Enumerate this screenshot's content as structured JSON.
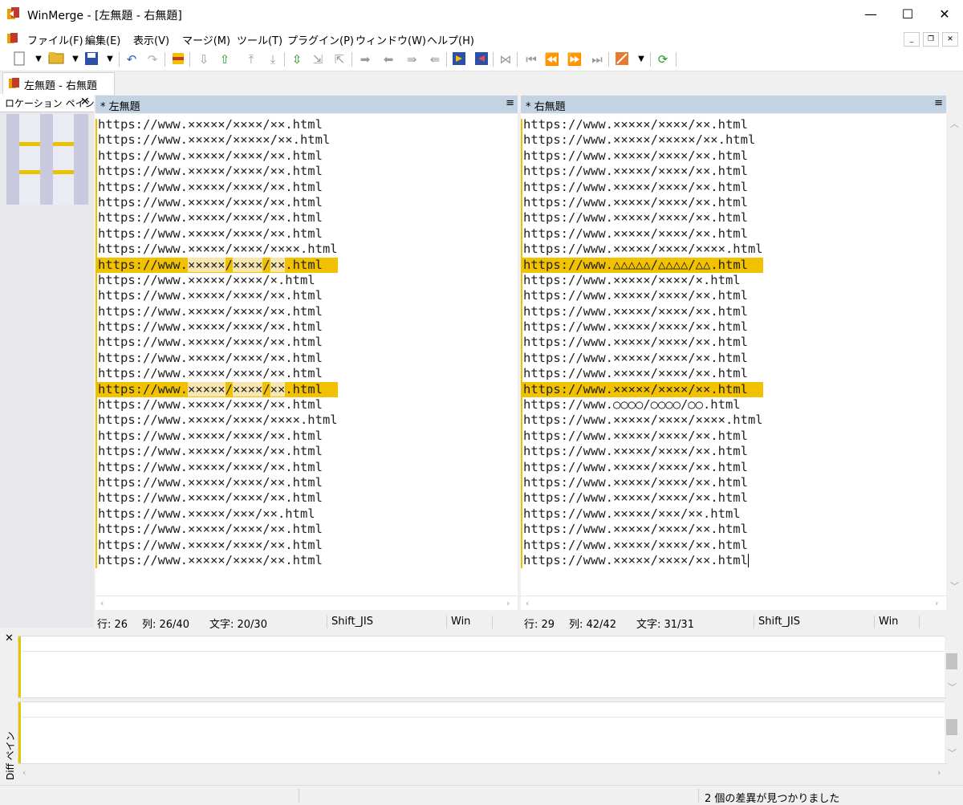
{
  "window": {
    "title": "WinMerge - [左無題 - 右無題]",
    "minimize_glyph": "—",
    "maximize_glyph": "☐",
    "close_glyph": "✕"
  },
  "menu": [
    "ファイル(F)",
    "編集(E)",
    "表示(V)",
    "マージ(M)",
    "ツール(T)",
    "プラグイン(P)",
    "ウィンドウ(W)",
    "ヘルプ(H)"
  ],
  "tab": {
    "label": "左無題 - 右無題"
  },
  "location_pane": {
    "title": "ロケーション ペイン",
    "close_glyph": "✕"
  },
  "left_pane": {
    "header": "* 左無題",
    "menu_glyph": "≡",
    "status": {
      "line": "行: 26",
      "col": "列: 26/40",
      "char": "文字: 20/30",
      "encoding": "Shift_JIS",
      "eol": "Win"
    }
  },
  "right_pane": {
    "header": "* 右無題",
    "menu_glyph": "≡",
    "status": {
      "line": "行: 29",
      "col": "列: 42/42",
      "char": "文字: 31/31",
      "encoding": "Shift_JIS",
      "eol": "Win"
    }
  },
  "left_lines": [
    "https://www.×××××/××××/××.html",
    "https://www.×××××/×××××/××.html",
    "https://www.×××××/××××/××.html",
    "https://www.×××××/××××/××.html",
    "https://www.×××××/××××/××.html",
    "https://www.×××××/××××/××.html",
    "https://www.×××××/××××/××.html",
    "https://www.×××××/××××/××.html",
    "https://www.×××××/××××/××××.html",
    "https://www.×××××/××××/××.html",
    "https://www.×××××/××××/×.html",
    "https://www.×××××/××××/××.html",
    "https://www.×××××/××××/××.html",
    "https://www.×××××/××××/××.html",
    "https://www.×××××/××××/××.html",
    "https://www.×××××/××××/××.html",
    "https://www.×××××/××××/××.html",
    "https://www.×××××/××××/××.html",
    "https://www.×××××/××××/××.html",
    "https://www.×××××/××××/××××.html",
    "https://www.×××××/××××/××.html",
    "https://www.×××××/××××/××.html",
    "https://www.×××××/××××/××.html",
    "https://www.×××××/××××/××.html",
    "https://www.×××××/××××/××.html",
    "https://www.×××××/×××/××.html",
    "https://www.×××××/××××/××.html",
    "https://www.×××××/××××/××.html",
    "https://www.×××××/××××/××.html"
  ],
  "right_lines": [
    "https://www.×××××/××××/××.html",
    "https://www.×××××/×××××/××.html",
    "https://www.×××××/××××/××.html",
    "https://www.×××××/××××/××.html",
    "https://www.×××××/××××/××.html",
    "https://www.×××××/××××/××.html",
    "https://www.×××××/××××/××.html",
    "https://www.×××××/××××/××.html",
    "https://www.×××××/××××/××××.html",
    "https://www.△△△△△/△△△△/△△.html",
    "https://www.×××××/××××/×.html",
    "https://www.×××××/××××/××.html",
    "https://www.×××××/××××/××.html",
    "https://www.×××××/××××/××.html",
    "https://www.×××××/××××/××.html",
    "https://www.×××××/××××/××.html",
    "https://www.×××××/××××/××.html",
    "https://www.×××××/××××/××.html",
    "https://www.○○○○/○○○○/○○.html",
    "https://www.×××××/××××/××××.html",
    "https://www.×××××/××××/××.html",
    "https://www.×××××/××××/××.html",
    "https://www.×××××/××××/××.html",
    "https://www.×××××/××××/××.html",
    "https://www.×××××/××××/××.html",
    "https://www.×××××/×××/××.html",
    "https://www.×××××/××××/××.html",
    "https://www.×××××/××××/××.html",
    "https://www.×××××/××××/××.html"
  ],
  "diff_line_indices": [
    9,
    17
  ],
  "diff_pane_label": "Diff ペイン",
  "main_status": "2 個の差異が見つかりました",
  "colors": {
    "diff": "#f2c200",
    "diff_word": "#f7e6b2",
    "pane_header": "#c3d3e4"
  }
}
